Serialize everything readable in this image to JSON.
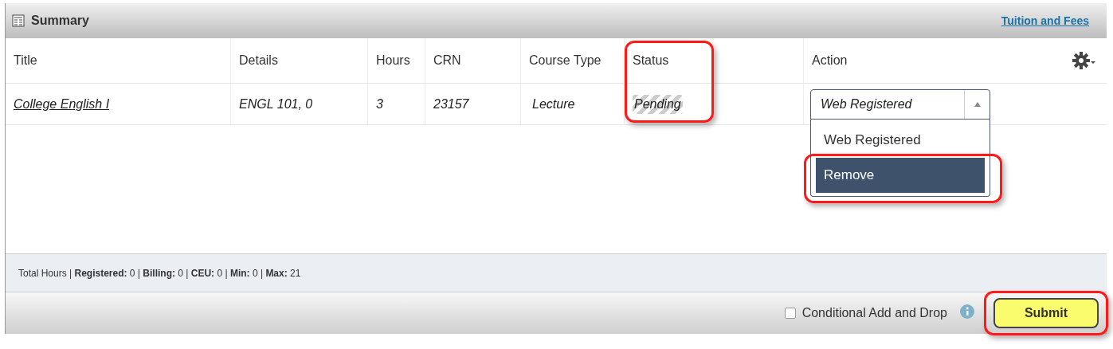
{
  "panel": {
    "title": "Summary",
    "link": "Tuition and Fees"
  },
  "table": {
    "columns": [
      "Title",
      "Details",
      "Hours",
      "CRN",
      "Course Type",
      "Status",
      "Action"
    ],
    "rows": [
      {
        "title": "College English I",
        "details": "ENGL 101, 0",
        "hours": "3",
        "crn": "23157",
        "course_type": "Lecture",
        "status": "Pending",
        "action": "Web Registered"
      }
    ]
  },
  "dropdown": {
    "expanded": true,
    "options": [
      {
        "label": "Web Registered",
        "selected": false
      },
      {
        "label": "Remove",
        "selected": true
      }
    ]
  },
  "totals": "Total Hours | **Registered:** 0 | **Billing:** 0 | **CEU:** 0 | **Min:** 0 | **Max:** 21",
  "conditional": {
    "label": "Conditional Add and Drop",
    "checked": false
  },
  "submit": "Submit"
}
